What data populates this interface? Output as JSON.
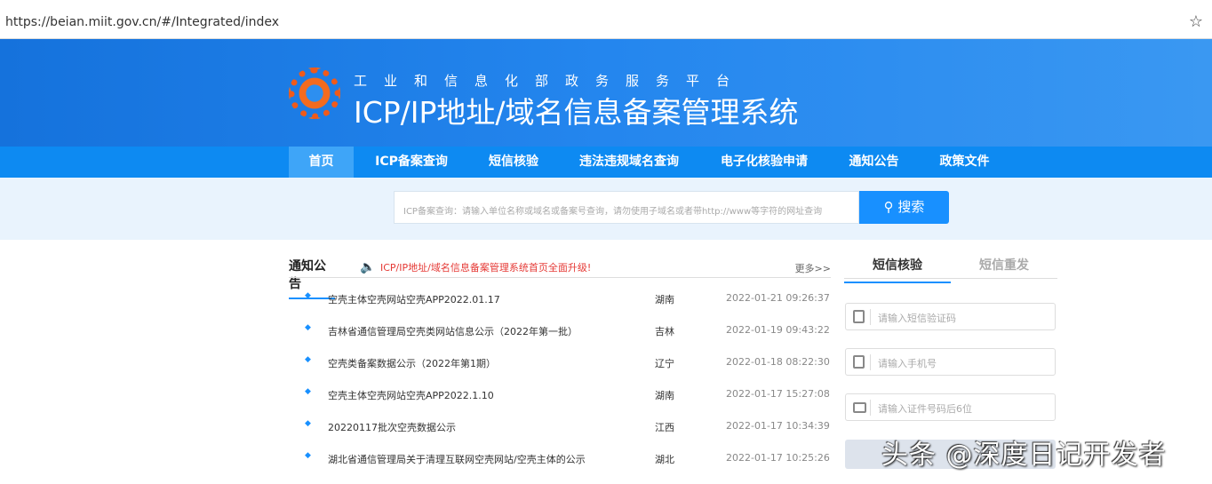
{
  "browser": {
    "url": "https://beian.miit.gov.cn/#/Integrated/index",
    "star_icon": "☆"
  },
  "header": {
    "subtitle": "工业和信息化部政务服务平台",
    "title": "ICP/IP地址/域名信息备案管理系统"
  },
  "nav": [
    "首页",
    "ICP备案查询",
    "短信核验",
    "违法违规域名查询",
    "电子化核验申请",
    "通知公告",
    "政策文件"
  ],
  "search": {
    "placeholder": "ICP备案查询：请输入单位名称或域名或备案号查询，请勿使用子域名或者带http://www等字符的网址查询",
    "button": "搜索"
  },
  "notice": {
    "title": "通知公告",
    "alert": "ICP/IP地址/域名信息备案管理系统首页全面升级!",
    "more": "更多>>",
    "items": [
      {
        "title": "空壳主体空壳网站空壳APP2022.01.17",
        "province": "湖南",
        "date": "2022-01-21 09:26:37"
      },
      {
        "title": "吉林省通信管理局空壳类网站信息公示（2022年第一批）",
        "province": "吉林",
        "date": "2022-01-19 09:43:22"
      },
      {
        "title": "空壳类备案数据公示（2022年第1期）",
        "province": "辽宁",
        "date": "2022-01-18 08:22:30"
      },
      {
        "title": "空壳主体空壳网站空壳APP2022.1.10",
        "province": "湖南",
        "date": "2022-01-17 15:27:08"
      },
      {
        "title": "20220117批次空壳数据公示",
        "province": "江西",
        "date": "2022-01-17 10:34:39"
      },
      {
        "title": "湖北省通信管理局关于清理互联网空壳网站/空壳主体的公示",
        "province": "湖北",
        "date": "2022-01-17 10:25:26"
      }
    ]
  },
  "sms": {
    "tabs": [
      "短信核验",
      "短信重发"
    ],
    "fields": [
      "请输入短信验证码",
      "请输入手机号",
      "请输入证件号码后6位"
    ]
  },
  "watermark": "头条 @深度日记开发者"
}
